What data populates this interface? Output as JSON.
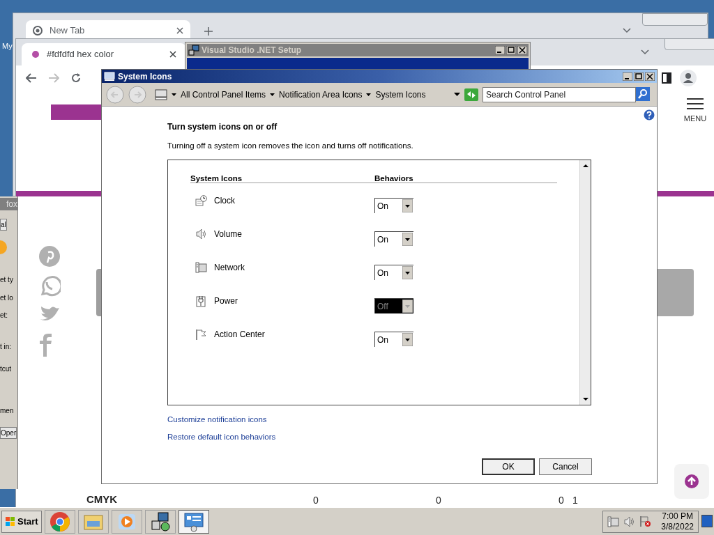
{
  "desktop": {
    "icon_label": "My"
  },
  "side_window": {
    "title": "fox",
    "fragments": [
      "al",
      "et ty",
      "et lo",
      "et:",
      "t in:",
      "tcut",
      "men",
      "Oper"
    ]
  },
  "back_browser": {
    "tab": {
      "title": "New Tab"
    }
  },
  "browser": {
    "tab": {
      "title": "#fdfdfd hex color"
    },
    "menu_label": "MENU",
    "table_row": {
      "label": "CMYK",
      "cells": [
        "0",
        "0",
        "0",
        "1"
      ]
    }
  },
  "setup_window": {
    "title": "Visual Studio .NET Setup"
  },
  "dialog": {
    "title": "System Icons",
    "breadcrumbs": [
      "All Control Panel Items",
      "Notification Area Icons",
      "System Icons"
    ],
    "search": {
      "placeholder": "Search Control Panel"
    },
    "heading": "Turn system icons on or off",
    "description": "Turning off a system icon removes the icon and turns off notifications.",
    "columns": [
      "System Icons",
      "Behaviors"
    ],
    "rows": [
      {
        "kind": "clock",
        "name": "Clock",
        "behavior": "On",
        "disabled": false
      },
      {
        "kind": "volume",
        "name": "Volume",
        "behavior": "On",
        "disabled": false
      },
      {
        "kind": "network",
        "name": "Network",
        "behavior": "On",
        "disabled": false
      },
      {
        "kind": "power",
        "name": "Power",
        "behavior": "Off",
        "disabled": true
      },
      {
        "kind": "flag",
        "name": "Action Center",
        "behavior": "On",
        "disabled": false
      }
    ],
    "links": [
      "Customize notification icons",
      "Restore default icon behaviors"
    ],
    "buttons": [
      {
        "label": "OK",
        "default": true
      },
      {
        "label": "Cancel",
        "default": false
      }
    ]
  },
  "taskbar": {
    "start": "Start",
    "apps": [
      {
        "kind": "chrome",
        "selected": false
      },
      {
        "kind": "folder",
        "selected": false
      },
      {
        "kind": "media",
        "selected": false
      },
      {
        "kind": "setup",
        "selected": false
      },
      {
        "kind": "control",
        "selected": true
      }
    ],
    "clock": {
      "time": "7:00 PM",
      "date": "3/8/2022"
    }
  }
}
